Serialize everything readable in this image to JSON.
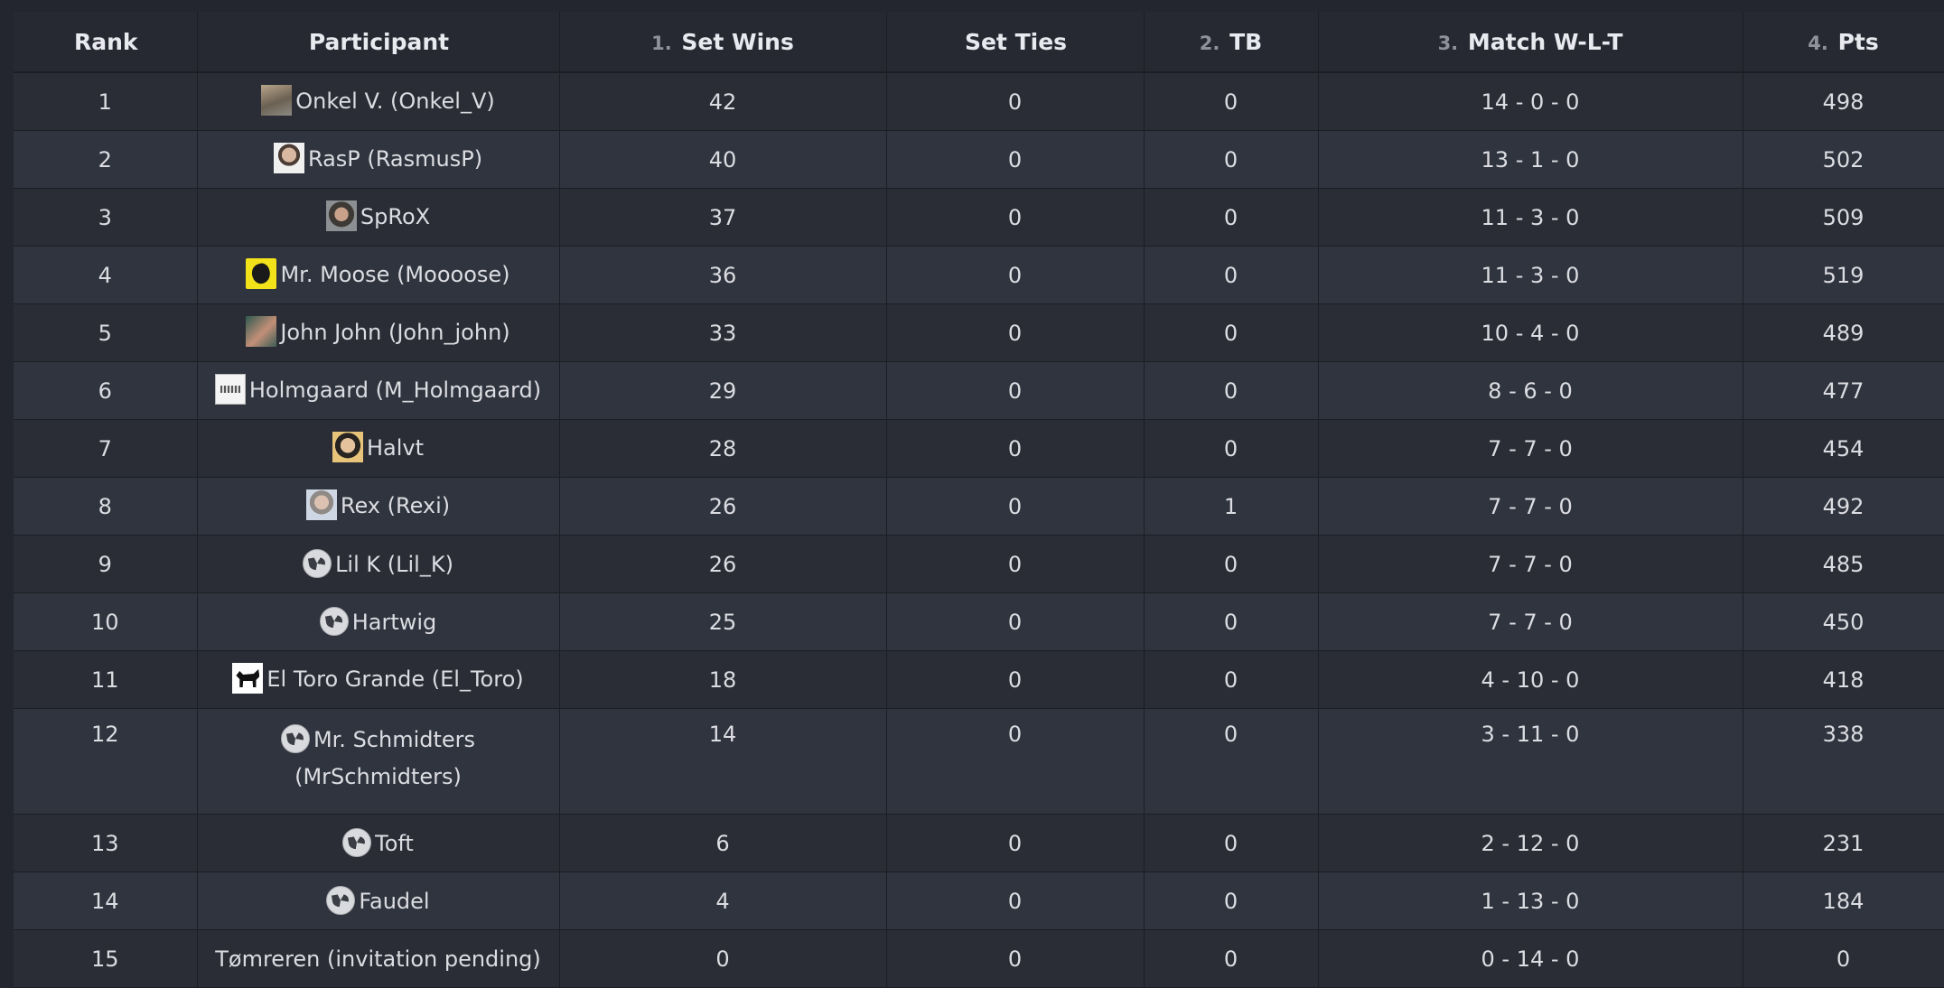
{
  "table": {
    "columns": [
      {
        "num": "",
        "label": "Rank"
      },
      {
        "num": "",
        "label": "Participant"
      },
      {
        "num": "1.",
        "label": "Set Wins"
      },
      {
        "num": "",
        "label": "Set Ties"
      },
      {
        "num": "2.",
        "label": "TB"
      },
      {
        "num": "3.",
        "label": "Match W-L-T"
      },
      {
        "num": "4.",
        "label": "Pts"
      }
    ],
    "rows": [
      {
        "rank": "1",
        "participant": "Onkel V. (Onkel_V)",
        "avatar": "photo-avatar",
        "set_wins": "42",
        "set_ties": "0",
        "tb": "0",
        "match": "14 - 0 - 0",
        "pts": "498"
      },
      {
        "rank": "2",
        "participant": "RasP (RasmusP)",
        "avatar": "face-avatar",
        "set_wins": "40",
        "set_ties": "0",
        "tb": "0",
        "match": "13 - 1 - 0",
        "pts": "502"
      },
      {
        "rank": "3",
        "participant": "SpRoX",
        "avatar": "face-avatar",
        "set_wins": "37",
        "set_ties": "0",
        "tb": "0",
        "match": "11 - 3 - 0",
        "pts": "509"
      },
      {
        "rank": "4",
        "participant": "Mr. Moose (Moooose)",
        "avatar": "moose-avatar",
        "set_wins": "36",
        "set_ties": "0",
        "tb": "0",
        "match": "11 - 3 - 0",
        "pts": "519"
      },
      {
        "rank": "5",
        "participant": "John John (John_john)",
        "avatar": "photo-avatar",
        "set_wins": "33",
        "set_ties": "0",
        "tb": "0",
        "match": "10 - 4 - 0",
        "pts": "489"
      },
      {
        "rank": "6",
        "participant": "Holmgaard (M_Holmgaard)",
        "avatar": "logo-avatar",
        "set_wins": "29",
        "set_ties": "0",
        "tb": "0",
        "match": "8 - 6 - 0",
        "pts": "477"
      },
      {
        "rank": "7",
        "participant": "Halvt",
        "avatar": "face-avatar",
        "set_wins": "28",
        "set_ties": "0",
        "tb": "0",
        "match": "7 - 7 - 0",
        "pts": "454"
      },
      {
        "rank": "8",
        "participant": "Rex (Rexi)",
        "avatar": "face-avatar",
        "set_wins": "26",
        "set_ties": "0",
        "tb": "1",
        "match": "7 - 7 - 0",
        "pts": "492"
      },
      {
        "rank": "9",
        "participant": "Lil K (Lil_K)",
        "avatar": "default-avatar",
        "set_wins": "26",
        "set_ties": "0",
        "tb": "0",
        "match": "7 - 7 - 0",
        "pts": "485"
      },
      {
        "rank": "10",
        "participant": "Hartwig",
        "avatar": "default-avatar",
        "set_wins": "25",
        "set_ties": "0",
        "tb": "0",
        "match": "7 - 7 - 0",
        "pts": "450"
      },
      {
        "rank": "11",
        "participant": "El Toro Grande (El_Toro)",
        "avatar": "bull-avatar",
        "set_wins": "18",
        "set_ties": "0",
        "tb": "0",
        "match": "4 - 10 - 0",
        "pts": "418"
      },
      {
        "rank": "12",
        "participant": "Mr. Schmidters (MrSchmidters)",
        "avatar": "default-avatar",
        "set_wins": "14",
        "set_ties": "0",
        "tb": "0",
        "match": "3 - 11 - 0",
        "pts": "338"
      },
      {
        "rank": "13",
        "participant": "Toft",
        "avatar": "default-avatar",
        "set_wins": "6",
        "set_ties": "0",
        "tb": "0",
        "match": "2 - 12 - 0",
        "pts": "231"
      },
      {
        "rank": "14",
        "participant": "Faudel",
        "avatar": "default-avatar",
        "set_wins": "4",
        "set_ties": "0",
        "tb": "0",
        "match": "1 - 13 - 0",
        "pts": "184"
      },
      {
        "rank": "15",
        "participant": "Tømreren (invitation pending)",
        "avatar": "",
        "set_wins": "0",
        "set_ties": "0",
        "tb": "0",
        "match": "0 - 14 - 0",
        "pts": "0"
      }
    ]
  },
  "colors": {
    "background": "#23262e",
    "row_odd": "#2a2d36",
    "row_even": "#30343e",
    "text": "#dcdde2",
    "header_number": "#8f929c"
  }
}
